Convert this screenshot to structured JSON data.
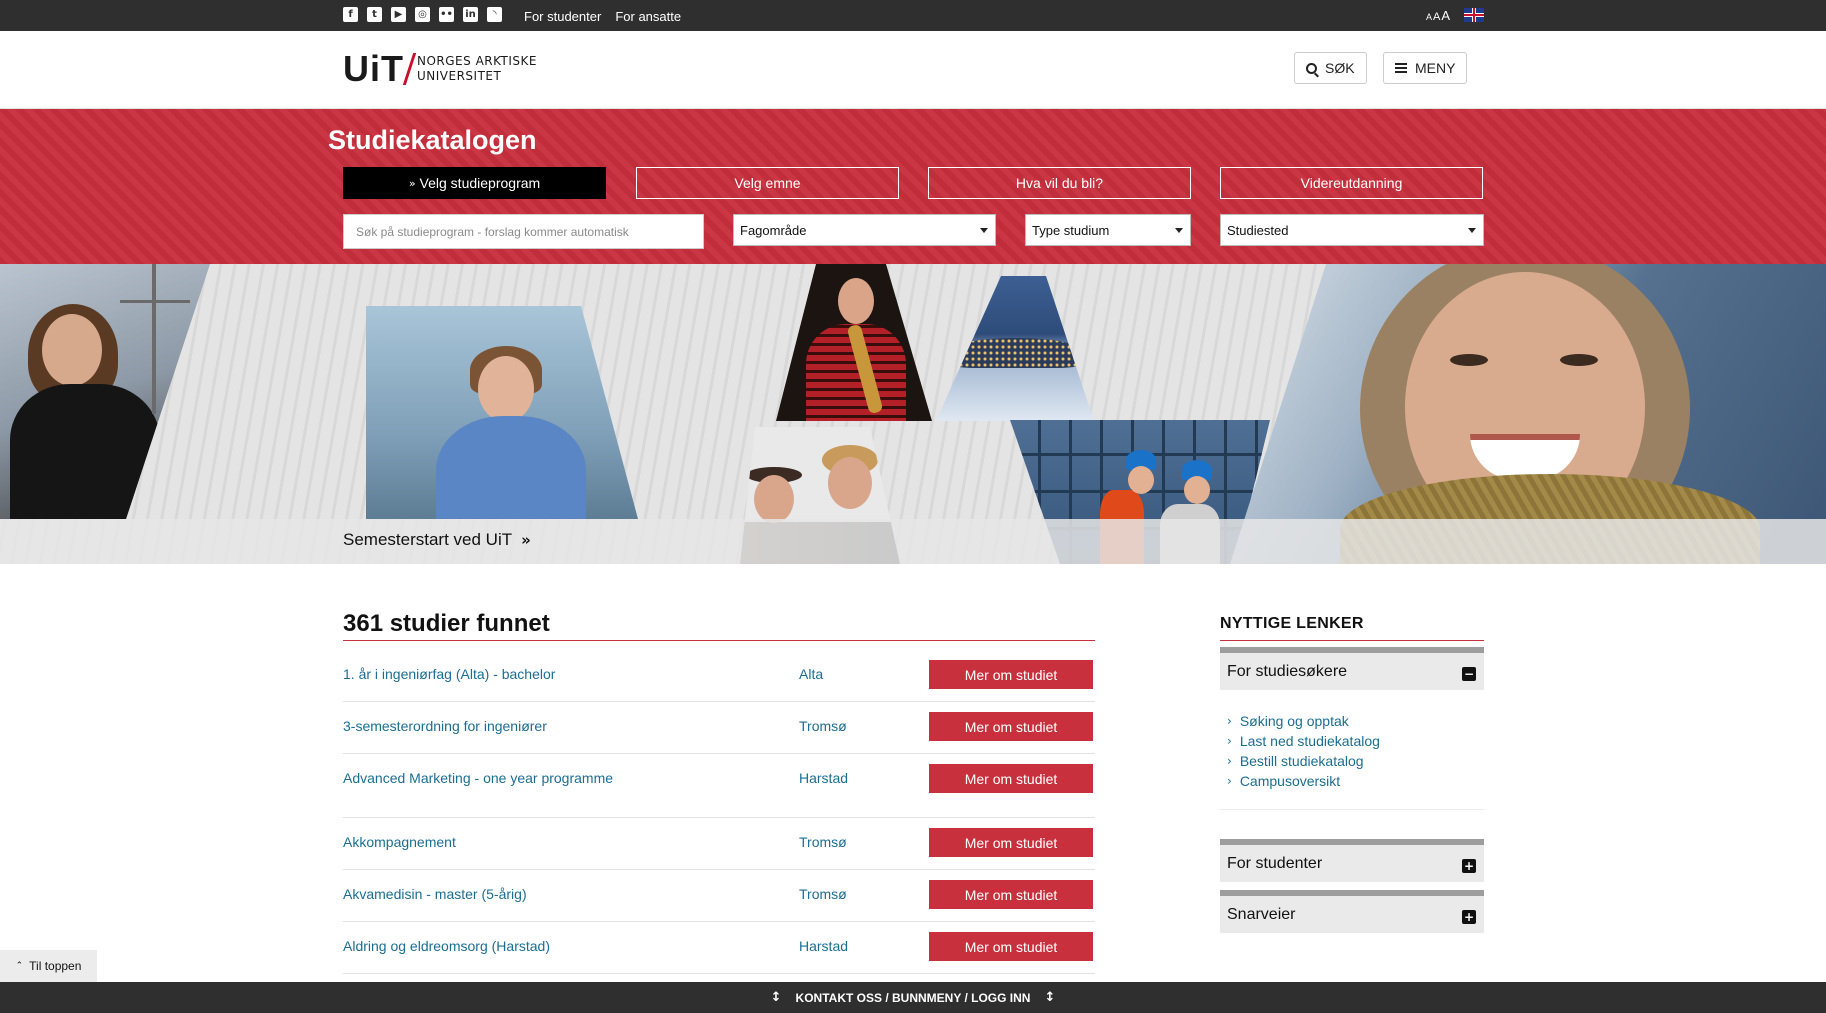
{
  "topbar": {
    "social_icons": [
      "facebook-icon",
      "twitter-icon",
      "youtube-icon",
      "instagram-icon",
      "flickr-icon",
      "linkedin-icon",
      "rss-icon"
    ],
    "links": [
      "For studenter",
      "For ansatte"
    ],
    "font_size_label": [
      "A",
      "A",
      "A"
    ],
    "language_icon": "uk-flag-icon"
  },
  "header": {
    "logo_short": "UiT",
    "logo_line1": "NORGES ARKTISKE",
    "logo_line2": "UNIVERSITET",
    "search_label": "SØK",
    "menu_label": "MENY"
  },
  "catalog": {
    "title": "Studiekatalogen",
    "tabs": [
      {
        "label": "Velg studieprogram",
        "active": true
      },
      {
        "label": "Velg emne",
        "active": false
      },
      {
        "label": "Hva vil du bli?",
        "active": false
      },
      {
        "label": "Videreutdanning",
        "active": false
      }
    ],
    "search_placeholder": "Søk på studieprogram - forslag kommer automatisk",
    "filters": [
      "Fagområde",
      "Type studium",
      "Studiested"
    ]
  },
  "hero": {
    "caption": "Semesterstart ved UiT"
  },
  "results": {
    "title": "361 studier funnet",
    "button_label": "Mer om studiet",
    "rows": [
      {
        "name": "1. år i ingeniørfag (Alta) - bachelor",
        "place": "Alta"
      },
      {
        "name": "3-semesterordning for ingeniører",
        "place": "Tromsø"
      },
      {
        "name": "Advanced Marketing - one year programme",
        "place": "Harstad"
      },
      {
        "name": "Akkompagnement",
        "place": "Tromsø"
      },
      {
        "name": "Akvamedisin - master (5-årig)",
        "place": "Tromsø"
      },
      {
        "name": "Aldring og eldreomsorg (Harstad)",
        "place": "Harstad"
      }
    ]
  },
  "sidebar": {
    "title": "NYTTIGE LENKER",
    "sections": [
      {
        "label": "For studiesøkere",
        "expanded": true,
        "toggle": "−"
      },
      {
        "label": "For studenter",
        "expanded": false,
        "toggle": "+"
      },
      {
        "label": "Snarveier",
        "expanded": false,
        "toggle": "+"
      }
    ],
    "links": [
      "Søking og opptak",
      "Last ned studiekatalog",
      "Bestill studiekatalog",
      "Campusoversikt"
    ]
  },
  "footer": {
    "to_top": "Til toppen",
    "bar_text": "KONTAKT OSS / BUNNMENY / LOGG INN"
  },
  "colors": {
    "accent_red": "#c8303d",
    "link_blue": "#1a6e93",
    "dark_bar": "#2f2f2f"
  }
}
